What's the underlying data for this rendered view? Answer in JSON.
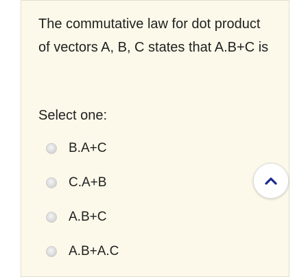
{
  "question": {
    "text": "The commutative law for dot product of vectors A, B, C states that A.B+C is",
    "select_prompt": "Select one:",
    "options": [
      {
        "label": "B.A+C"
      },
      {
        "label": "C.A+B"
      },
      {
        "label": "A.B+C"
      },
      {
        "label": "A.B+A.C"
      }
    ]
  },
  "scroll_top_button": {
    "icon": "chevron-up-icon",
    "color": "#1a2a8c"
  },
  "colors": {
    "card_background": "#fcf9ea",
    "text": "#1f1f1f"
  }
}
